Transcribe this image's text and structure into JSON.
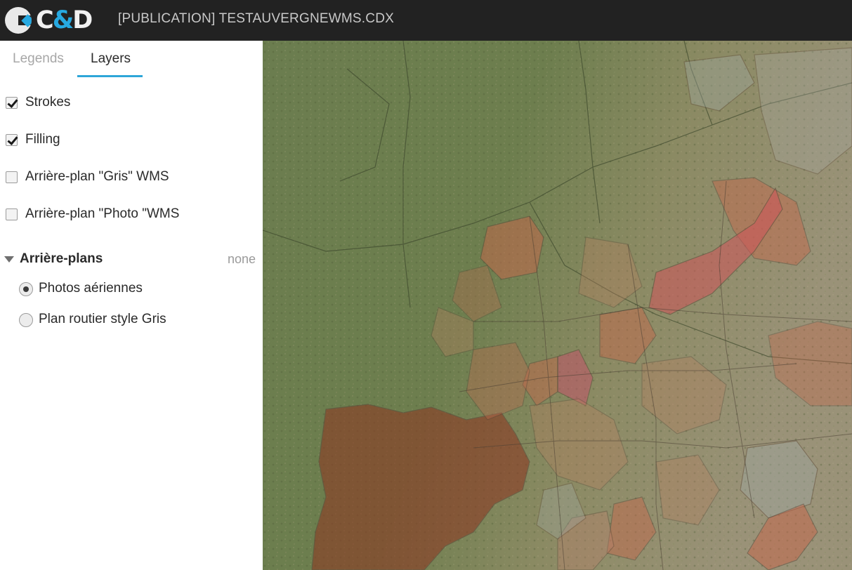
{
  "header": {
    "logo_prefix": "C",
    "logo_amp": "&",
    "logo_suffix": "D",
    "title": "[PUBLICATION] TESTAUVERGNEWMS.CDX"
  },
  "tabs": [
    {
      "label": "Legends",
      "active": false
    },
    {
      "label": "Layers",
      "active": true
    }
  ],
  "layers": [
    {
      "label": "Strokes",
      "checked": true
    },
    {
      "label": "Filling",
      "checked": true
    },
    {
      "label": "Arrière-plan \"Gris\" WMS",
      "checked": false
    },
    {
      "label": "Arrière-plan \"Photo \"WMS",
      "checked": false
    }
  ],
  "backgrounds": {
    "label": "Arrière-plans",
    "value": "none",
    "options": [
      {
        "label": "Photos aériennes",
        "selected": true
      },
      {
        "label": "Plan routier style Gris",
        "selected": false
      }
    ]
  },
  "colors": {
    "header_bg": "#222222",
    "accent": "#2ea6d8",
    "polygon_fill": "#c8664a"
  }
}
